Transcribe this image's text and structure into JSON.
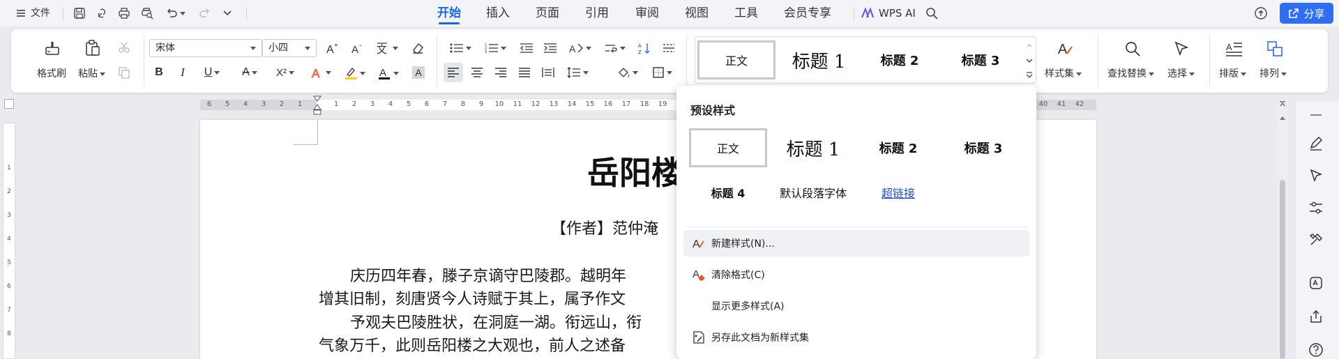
{
  "menubar": {
    "file_label": "文件",
    "tabs": [
      {
        "label": "开始",
        "active": true
      },
      {
        "label": "插入"
      },
      {
        "label": "页面"
      },
      {
        "label": "引用"
      },
      {
        "label": "审阅"
      },
      {
        "label": "视图"
      },
      {
        "label": "工具"
      },
      {
        "label": "会员专享"
      }
    ],
    "wps_ai_label": "WPS AI",
    "share_label": "分享",
    "accent_color": "#1a66e8"
  },
  "ribbon": {
    "format_painter_label": "格式刷",
    "paste_label": "粘贴",
    "font_name": "宋体",
    "font_size": "小四",
    "style_set_label": "样式集",
    "find_replace_label": "查找替换",
    "select_label": "选择",
    "layout_label": "排版",
    "arrange_label": "排列",
    "gallery": {
      "normal": "正文",
      "heading1": "标题 1",
      "heading2": "标题 2",
      "heading3": "标题 3"
    }
  },
  "ruler": {
    "left_numbers": [
      "6",
      "5",
      "4",
      "3",
      "2",
      "1"
    ],
    "right_numbers": [
      "1",
      "2",
      "3",
      "4",
      "5",
      "6",
      "7",
      "8",
      "9",
      "10",
      "11",
      "12",
      "13",
      "14",
      "15",
      "16",
      "17",
      "18",
      "19"
    ],
    "end_numbers": [
      "40",
      "41",
      "42"
    ],
    "vertical_numbers": [
      "1",
      "2",
      "3",
      "4",
      "5",
      "6",
      "7",
      "8"
    ]
  },
  "document": {
    "title": "岳阳楼",
    "author": "【作者】范仲淹",
    "lines": [
      "庆历四年春，滕子京谪守巴陵郡。越明年",
      "增其旧制，刻唐贤今人诗赋于其上，属予作文",
      "予观夫巴陵胜状，在洞庭一湖。衔远山，衔",
      "气象万千，此则岳阳楼之大观也，前人之述备"
    ]
  },
  "dropdown": {
    "header": "预设样式",
    "styles": {
      "normal": "正文",
      "heading1": "标题 1",
      "heading2": "标题 2",
      "heading3": "标题 3",
      "heading4": "标题 4",
      "default_font": "默认段落字体",
      "hyperlink": "超链接"
    },
    "actions": [
      {
        "label": "新建样式(N)..."
      },
      {
        "label": "清除格式(C)"
      },
      {
        "label": "显示更多样式(A)"
      },
      {
        "label": "另存此文档为新样式集"
      }
    ]
  }
}
